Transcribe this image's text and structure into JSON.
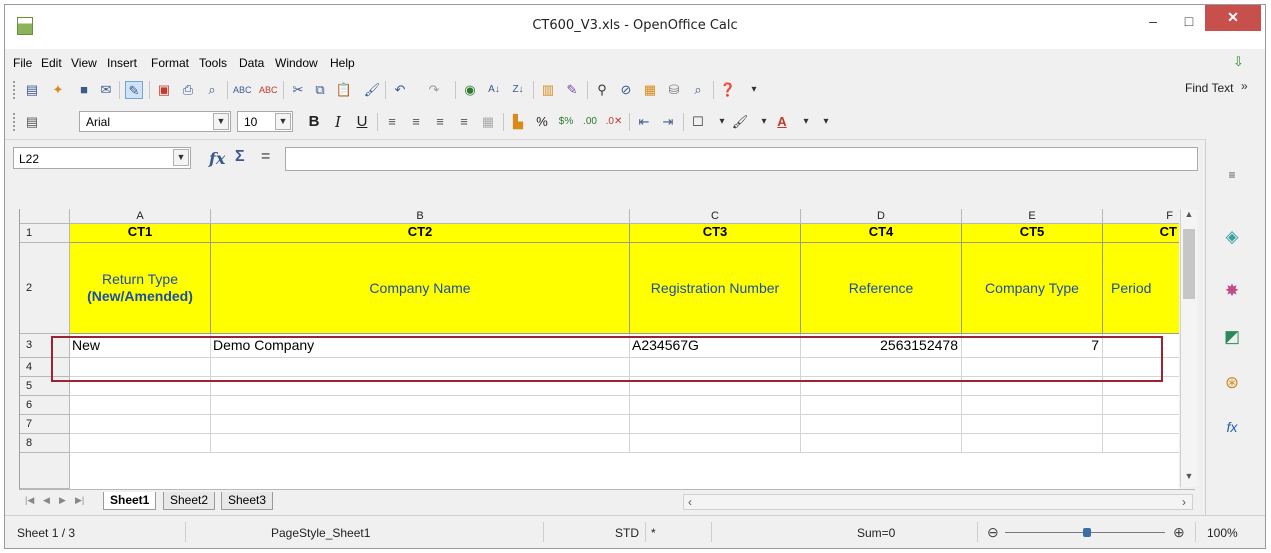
{
  "window": {
    "title": "CT600_V3.xls - OpenOffice Calc",
    "min_label": "–",
    "max_label": "□",
    "close_label": "✕"
  },
  "menu": [
    "File",
    "Edit",
    "View",
    "Insert",
    "Format",
    "Tools",
    "Data",
    "Window",
    "Help"
  ],
  "toolbar": {
    "find_text": "Find Text",
    "font_name": "Arial",
    "font_size": "10"
  },
  "formula_bar": {
    "cell_reference": "L22",
    "formula_value": ""
  },
  "grid": {
    "column_headers": [
      "A",
      "B",
      "C",
      "D",
      "E",
      "F"
    ],
    "row_headers": [
      "1",
      "2",
      "3",
      "4",
      "5",
      "6",
      "7",
      "8"
    ],
    "row1": [
      "CT1",
      "CT2",
      "CT3",
      "CT4",
      "CT5",
      "CT"
    ],
    "row2": [
      "Return Type",
      "(New/Amended)",
      "Company Name",
      "Registration Number",
      "Reference",
      "Company Type",
      "Period"
    ],
    "row3": [
      "New",
      "Demo Company",
      "A234567G",
      "2563152478",
      "7",
      ""
    ]
  },
  "sheet_tabs": [
    "Sheet1",
    "Sheet2",
    "Sheet3"
  ],
  "status_bar": {
    "sheet": "Sheet 1 / 3",
    "page_style": "PageStyle_Sheet1",
    "mode": "STD",
    "modified": "*",
    "sum": "Sum=0",
    "zoom": "100%"
  },
  "colors": {
    "header_fill": "#ffff00",
    "header_text_blue": "#1c4ea8",
    "highlight_border": "#9b2335",
    "close_button": "#c7504d"
  },
  "icons": {
    "toolbar1": [
      "new-icon",
      "template-icon",
      "save-icon",
      "email-icon",
      "edit-file-icon",
      "export-pdf-icon",
      "print-icon",
      "page-preview-icon",
      "spellcheck-icon",
      "autospell-icon",
      "cut-icon",
      "copy-icon",
      "paste-icon",
      "format-paintbrush-icon",
      "undo-icon",
      "redo-icon",
      "hyperlink-icon",
      "sort-ascending-icon",
      "sort-descending-icon",
      "chart-icon",
      "draw-functions-icon",
      "find-replace-icon",
      "navigator-icon",
      "gallery-icon",
      "datasource-icon",
      "zoom-icon",
      "help-icon"
    ],
    "sidebar": [
      "properties-icon",
      "styles-icon",
      "gallery-icon",
      "navigator-icon",
      "functions-icon"
    ]
  }
}
